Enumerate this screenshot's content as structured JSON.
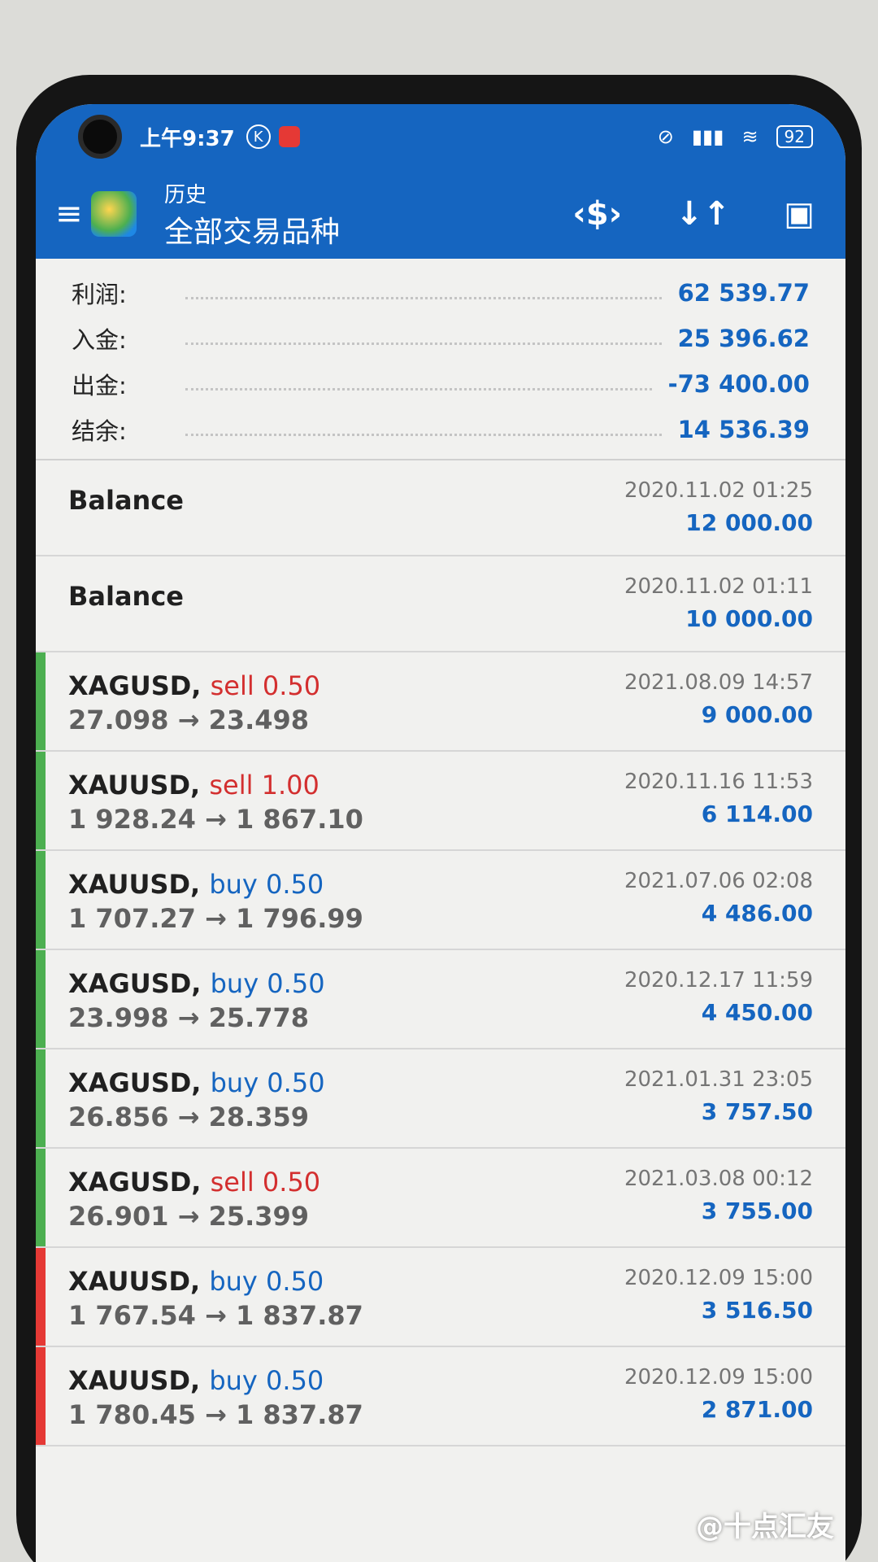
{
  "status_bar": {
    "time": "上午9:37",
    "k_icon": "K",
    "battery": "92"
  },
  "toolbar": {
    "subtitle": "历史",
    "title": "全部交易品种",
    "icons": [
      "menu-icon",
      "dollar-filter-icon",
      "sort-icon",
      "calendar-icon"
    ]
  },
  "summary": [
    {
      "label": "利润:",
      "value": "62 539.77"
    },
    {
      "label": "入金:",
      "value": "25 396.62"
    },
    {
      "label": "出金:",
      "value": "-73 400.00"
    },
    {
      "label": "结余:",
      "value": "14 536.39"
    }
  ],
  "balances": [
    {
      "title": "Balance",
      "time": "2020.11.02 01:25",
      "amount": "12 000.00"
    },
    {
      "title": "Balance",
      "time": "2020.11.02 01:11",
      "amount": "10 000.00"
    }
  ],
  "trades": [
    {
      "symbol": "XAGUSD,",
      "side": "sell 0.50",
      "prices": "27.098 → 23.498",
      "time": "2021.08.09 14:57",
      "amount": "9 000.00",
      "bar": "green"
    },
    {
      "symbol": "XAUUSD,",
      "side": "sell 1.00",
      "prices": "1 928.24 → 1 867.10",
      "time": "2020.11.16 11:53",
      "amount": "6 114.00",
      "bar": "green"
    },
    {
      "symbol": "XAUUSD,",
      "side": "buy 0.50",
      "prices": "1 707.27 → 1 796.99",
      "time": "2021.07.06 02:08",
      "amount": "4 486.00",
      "bar": "green"
    },
    {
      "symbol": "XAGUSD,",
      "side": "buy 0.50",
      "prices": "23.998 → 25.778",
      "time": "2020.12.17 11:59",
      "amount": "4 450.00",
      "bar": "green"
    },
    {
      "symbol": "XAGUSD,",
      "side": "buy 0.50",
      "prices": "26.856 → 28.359",
      "time": "2021.01.31 23:05",
      "amount": "3 757.50",
      "bar": "green"
    },
    {
      "symbol": "XAGUSD,",
      "side": "sell 0.50",
      "prices": "26.901 → 25.399",
      "time": "2021.03.08 00:12",
      "amount": "3 755.00",
      "bar": "green"
    },
    {
      "symbol": "XAUUSD,",
      "side": "buy 0.50",
      "prices": "1 767.54 → 1 837.87",
      "time": "2020.12.09 15:00",
      "amount": "3 516.50",
      "bar": "red"
    },
    {
      "symbol": "XAUUSD,",
      "side": "buy 0.50",
      "prices": "1 780.45 → 1 837.87",
      "time": "2020.12.09 15:00",
      "amount": "2 871.00",
      "bar": "red"
    }
  ],
  "watermark": "@十点汇友",
  "colors": {
    "accent": "#1565c0",
    "sell": "#d32f2f",
    "buy": "#1565c0",
    "profit_bar": "#4caf50",
    "loss_bar": "#e53935"
  }
}
